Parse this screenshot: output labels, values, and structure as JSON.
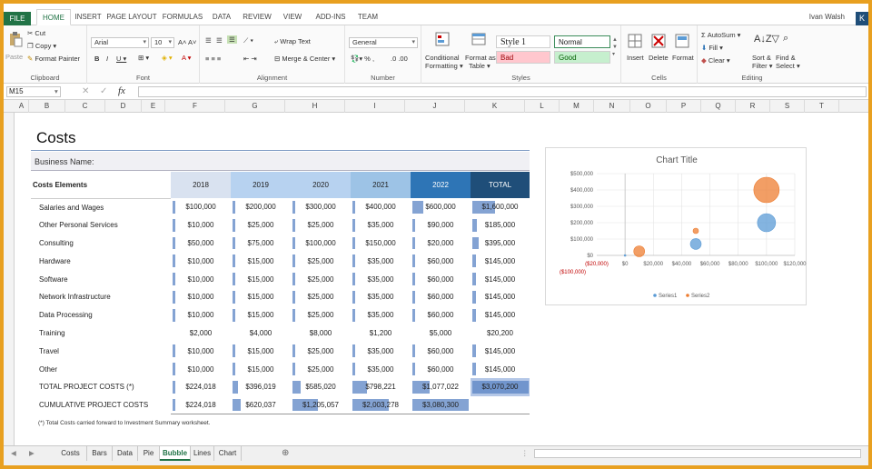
{
  "ribbon_tabs": [
    "FILE",
    "HOME",
    "INSERT",
    "PAGE LAYOUT",
    "FORMULAS",
    "DATA",
    "REVIEW",
    "VIEW",
    "ADD-INS",
    "TEAM"
  ],
  "user_name": "Ivan Walsh",
  "user_initial": "K",
  "clipboard": {
    "paste": "Paste",
    "cut": "Cut",
    "copy": "Copy",
    "format_painter": "Format Painter",
    "label": "Clipboard"
  },
  "font": {
    "name": "Arial",
    "size": "10",
    "label": "Font"
  },
  "alignment": {
    "wrap_text": "Wrap Text",
    "merge_center": "Merge & Center",
    "label": "Alignment"
  },
  "number": {
    "format": "General",
    "label": "Number"
  },
  "styles": {
    "conditional": "Conditional",
    "formatting": "Formatting",
    "format_as": "Format as",
    "table": "Table",
    "style1": "Style 1",
    "normal": "Normal",
    "bad": "Bad",
    "good": "Good",
    "label": "Styles"
  },
  "cells": {
    "insert": "Insert",
    "delete": "Delete",
    "format": "Format",
    "label": "Cells"
  },
  "editing": {
    "autosum": "AutoSum",
    "fill": "Fill",
    "clear": "Clear",
    "sort": "Sort &",
    "filter": "Filter",
    "find": "Find &",
    "select": "Select",
    "label": "Editing"
  },
  "name_box": "M15",
  "fx": "fx",
  "columns": [
    "A",
    "B",
    "C",
    "D",
    "E",
    "F",
    "G",
    "H",
    "I",
    "J",
    "K",
    "L",
    "M",
    "N",
    "O",
    "P",
    "Q",
    "R",
    "S",
    "T"
  ],
  "sheet": {
    "title": "Costs",
    "business_label": "Business Name:",
    "headers": [
      "Costs Elements",
      "2018",
      "2019",
      "2020",
      "2021",
      "2022",
      "TOTAL"
    ],
    "rows": [
      [
        "Salaries and Wages",
        "$100,000",
        "$200,000",
        "$300,000",
        "$400,000",
        "$600,000",
        "$1,600,000"
      ],
      [
        "Other Personal Services",
        "$10,000",
        "$25,000",
        "$25,000",
        "$35,000",
        "$90,000",
        "$185,000"
      ],
      [
        "Consulting",
        "$50,000",
        "$75,000",
        "$100,000",
        "$150,000",
        "$20,000",
        "$395,000"
      ],
      [
        "Hardware",
        "$10,000",
        "$15,000",
        "$25,000",
        "$35,000",
        "$60,000",
        "$145,000"
      ],
      [
        "Software",
        "$10,000",
        "$15,000",
        "$25,000",
        "$35,000",
        "$60,000",
        "$145,000"
      ],
      [
        "Network Infrastructure",
        "$10,000",
        "$15,000",
        "$25,000",
        "$35,000",
        "$60,000",
        "$145,000"
      ],
      [
        "Data Processing",
        "$10,000",
        "$15,000",
        "$25,000",
        "$35,000",
        "$60,000",
        "$145,000"
      ],
      [
        "Training",
        "$2,000",
        "$4,000",
        "$8,000",
        "$1,200",
        "$5,000",
        "$20,200"
      ],
      [
        "Travel",
        "$10,000",
        "$15,000",
        "$25,000",
        "$35,000",
        "$60,000",
        "$145,000"
      ],
      [
        "Other",
        "$10,000",
        "$15,000",
        "$25,000",
        "$35,000",
        "$60,000",
        "$145,000"
      ],
      [
        "TOTAL PROJECT COSTS  (*)",
        "$224,018",
        "$396,019",
        "$585,020",
        "$798,221",
        "$1,077,022",
        "$3,070,200"
      ],
      [
        "CUMULATIVE PROJECT COSTS",
        "$224,018",
        "$620,037",
        "$1,205,057",
        "$2,003,278",
        "$3,080,300",
        ""
      ]
    ],
    "bar_fraction": [
      [
        0.03,
        0.03,
        0.03,
        0.03,
        0.2,
        0.4
      ],
      [
        0.02,
        0.02,
        0.02,
        0.02,
        0.02,
        0.08
      ],
      [
        0.02,
        0.02,
        0.02,
        0.02,
        0.02,
        0.12
      ],
      [
        0.02,
        0.02,
        0.02,
        0.02,
        0.02,
        0.07
      ],
      [
        0.02,
        0.02,
        0.02,
        0.02,
        0.02,
        0.07
      ],
      [
        0.02,
        0.02,
        0.02,
        0.02,
        0.02,
        0.07
      ],
      [
        0.02,
        0.02,
        0.02,
        0.02,
        0.02,
        0.07
      ],
      [
        0,
        0,
        0,
        0,
        0,
        0
      ],
      [
        0.02,
        0.02,
        0.02,
        0.02,
        0.02,
        0.07
      ],
      [
        0.02,
        0.02,
        0.02,
        0.02,
        0.02,
        0.07
      ],
      [
        0.05,
        0.1,
        0.15,
        0.25,
        0.3,
        1.0
      ],
      [
        0.05,
        0.15,
        0.45,
        0.65,
        1.0,
        0
      ]
    ],
    "footnote": "(*) Total Costs carried forward to Investment Summary worksheet."
  },
  "header_colors": [
    "#d9e2f0",
    "#b7d2f0",
    "#b7d2f0",
    "#9dc3e6",
    "#2e75b6",
    "#1f4e79"
  ],
  "sheet_tabs": [
    "Costs",
    "Bars",
    "Data",
    "Pie",
    "Bubble",
    "Lines",
    "Chart"
  ],
  "active_sheet": "Bubble",
  "chart_data": {
    "type": "scatter",
    "title": "Chart Title",
    "xlim": [
      -20000,
      120000
    ],
    "ylim": [
      -100000,
      500000
    ],
    "x_ticks": [
      "($20,000)",
      "$0",
      "$20,000",
      "$40,000",
      "$60,000",
      "$80,000",
      "$100,000",
      "$120,000"
    ],
    "y_ticks": [
      "($100,000)",
      "$0",
      "$100,000",
      "$200,000",
      "$300,000",
      "$400,000",
      "$500,000"
    ],
    "series": [
      {
        "name": "Series1",
        "color": "#5b9bd5",
        "points": [
          {
            "x": 0,
            "y": 0,
            "r": 1
          },
          {
            "x": 50000,
            "y": 70000,
            "r": 6
          },
          {
            "x": 100000,
            "y": 200000,
            "r": 10
          }
        ]
      },
      {
        "name": "Series2",
        "color": "#ed7d31",
        "points": [
          {
            "x": 10000,
            "y": 25000,
            "r": 6
          },
          {
            "x": 50000,
            "y": 150000,
            "r": 3
          },
          {
            "x": 100000,
            "y": 400000,
            "r": 14
          }
        ]
      }
    ],
    "legend": "bottom"
  }
}
